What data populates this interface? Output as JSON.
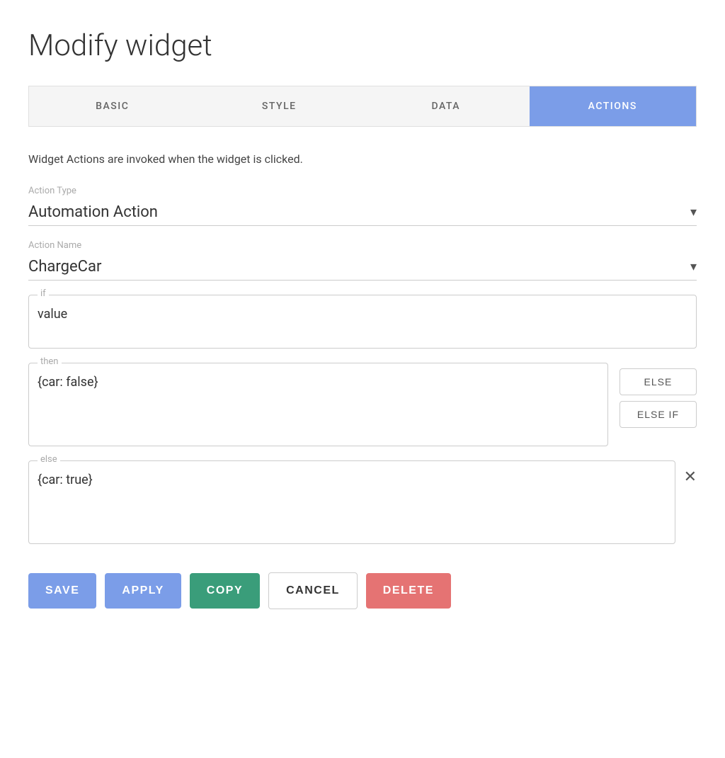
{
  "page": {
    "title": "Modify widget"
  },
  "tabs": [
    {
      "id": "basic",
      "label": "BASIC",
      "active": false
    },
    {
      "id": "style",
      "label": "STYLE",
      "active": false
    },
    {
      "id": "data",
      "label": "DATA",
      "active": false
    },
    {
      "id": "actions",
      "label": "ACTIONS",
      "active": true
    }
  ],
  "description": "Widget Actions are invoked when the widget is clicked.",
  "action_type": {
    "label": "Action Type",
    "value": "Automation Action"
  },
  "action_name": {
    "label": "Action Name",
    "value": "ChargeCar"
  },
  "if_section": {
    "legend": "if",
    "value": "value"
  },
  "then_section": {
    "legend": "then",
    "value": "{car: false}"
  },
  "else_section": {
    "legend": "else",
    "value": "{car: true}"
  },
  "buttons": {
    "else_label": "ELSE",
    "else_if_label": "ELSE IF",
    "save_label": "SAVE",
    "apply_label": "APPLY",
    "copy_label": "COPY",
    "cancel_label": "CANCEL",
    "delete_label": "DELETE"
  }
}
